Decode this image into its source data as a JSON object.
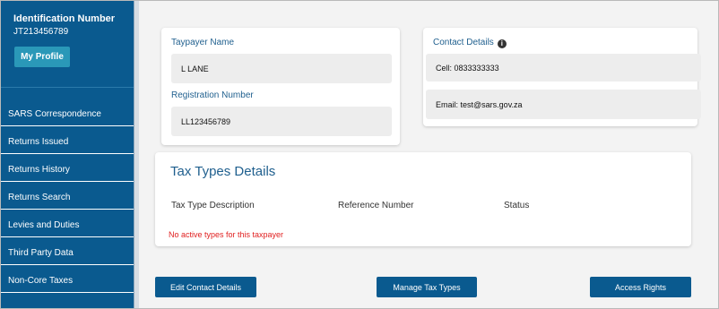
{
  "profile": {
    "id_heading": "Identification Number",
    "id_value": "JT213456789",
    "my_profile_label": "My Profile"
  },
  "sidebar": {
    "items": [
      {
        "label": "SARS Correspondence"
      },
      {
        "label": "Returns Issued"
      },
      {
        "label": "Returns History"
      },
      {
        "label": "Returns Search"
      },
      {
        "label": "Levies and Duties"
      },
      {
        "label": "Third Party Data"
      },
      {
        "label": "Non-Core Taxes"
      }
    ]
  },
  "taxpayer": {
    "name_label": "Taypayer Name",
    "name_value": "L LANE",
    "reg_label": "Registration Number",
    "reg_value": "LL123456789"
  },
  "contact": {
    "title": "Contact Details",
    "info_icon": "info-icon",
    "cell_label": "Cell:",
    "cell_value": "0833333333",
    "email_label": "Email:",
    "email_value": "test@sars.gov.za"
  },
  "tax_types": {
    "title": "Tax Types Details",
    "columns": [
      "Tax Type Description",
      "Reference Number",
      "Status"
    ],
    "empty_message": "No active types for this taxpayer"
  },
  "actions": {
    "edit_contact": "Edit Contact Details",
    "manage_tax_types": "Manage Tax Types",
    "access_rights": "Access Rights"
  },
  "colors": {
    "sidebar": "#0a5a8f",
    "profile_button": "#2a98b8",
    "heading_blue": "#1f5f8e",
    "error_red": "#e02020"
  }
}
